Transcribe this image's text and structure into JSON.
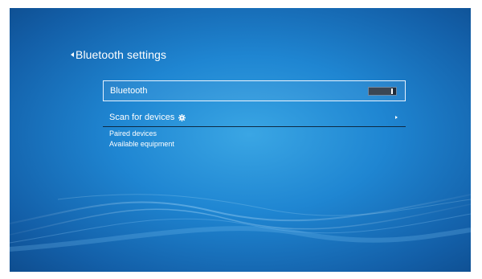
{
  "header": {
    "title": "Bluetooth settings"
  },
  "settings": {
    "bluetooth": {
      "label": "Bluetooth",
      "state": "on"
    },
    "scan": {
      "label": "Scan for devices"
    }
  },
  "sections": {
    "paired_label": "Paired devices",
    "available_label": "Available equipment"
  },
  "icons": {
    "back": "chevron-left-icon",
    "gear": "gear-icon",
    "arrow": "chevron-right-icon"
  },
  "colors": {
    "background_center": "#3aa6e4",
    "background_edge": "#0e4d8f",
    "text": "#ffffff",
    "selection_border": "#e8f3ff"
  }
}
